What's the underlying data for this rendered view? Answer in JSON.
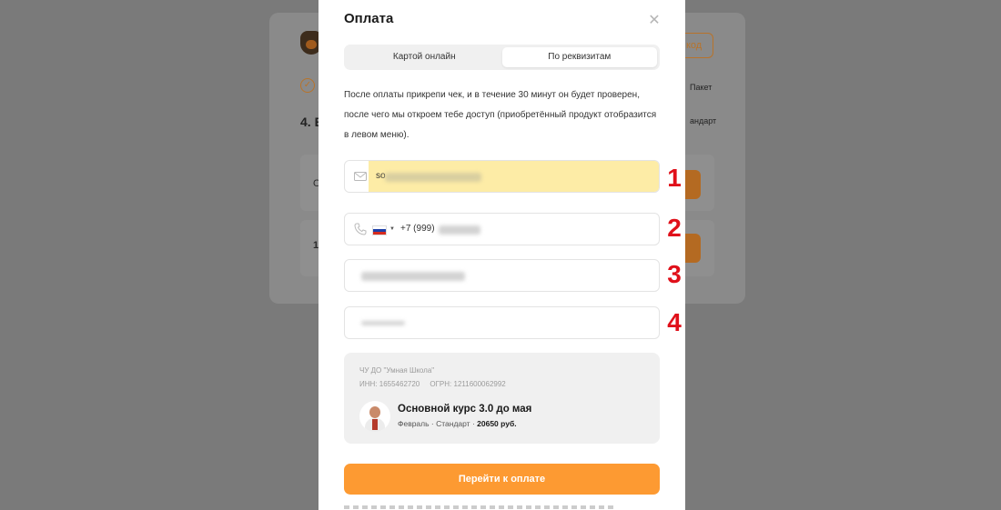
{
  "background": {
    "heading": "4. В",
    "row1_text": "О",
    "row2_text": "1",
    "right_button_fragment": "код",
    "right_text_1": "Пакет",
    "right_text_2": "андарт"
  },
  "modal": {
    "title": "Оплата",
    "tabs": [
      {
        "label": "Картой онлайн",
        "active": false
      },
      {
        "label": "По реквизитам",
        "active": true
      }
    ],
    "instruction": "После оплаты прикрепи чек, и в течение 30 минут он будет проверен, после чего мы откроем тебе доступ (приобретённый продукт отобразится в левом меню).",
    "fields": {
      "email_value": "so",
      "phone_country": "RU",
      "phone_value": "+7 (999)"
    },
    "annotations": [
      "1",
      "2",
      "3",
      "4"
    ],
    "org": {
      "name": "ЧУ ДО \"Умная Школа\"",
      "inn": "ИНН: 1655462720",
      "ogrn": "ОГРН: 1211600062992"
    },
    "course": {
      "title": "Основной курс 3.0 до мая",
      "meta_prefix": "Февраль · Стандарт · ",
      "price": "20650 руб."
    },
    "pay_button": "Перейти к оплате",
    "accent_color": "#fd9a32",
    "highlight_color": "#fdeca6",
    "annotation_color": "#e0101a"
  }
}
